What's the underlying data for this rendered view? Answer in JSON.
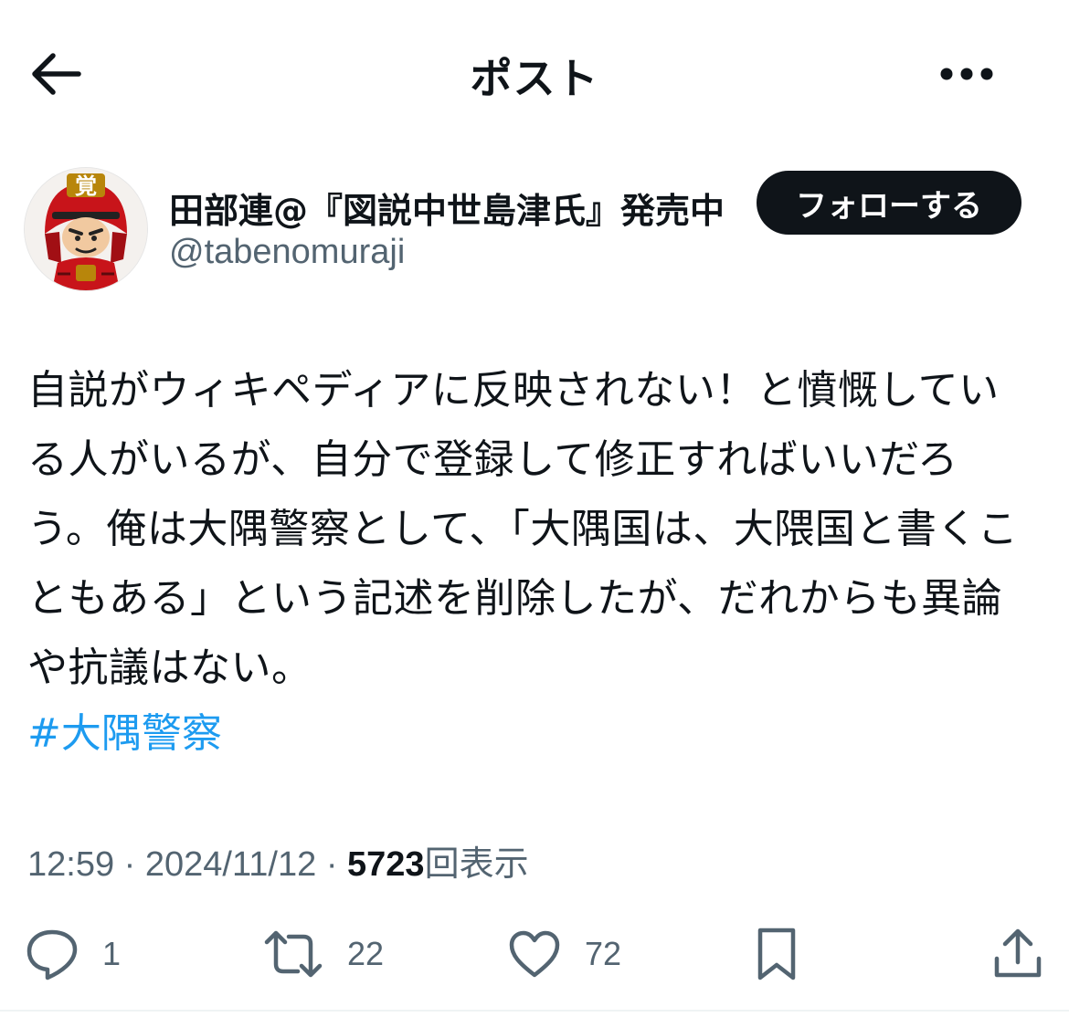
{
  "header": {
    "title": "ポスト"
  },
  "author": {
    "display_name": "田部連@『図説中世島津氏』発売中",
    "handle": "@tabenomuraji",
    "follow_label": "フォローする",
    "avatar_kanji": "覚"
  },
  "tweet": {
    "text": "自説がウィキペディアに反映されない！と憤慨している人がいるが、自分で登録して修正すればいいだろう。俺は大隅警察として、「大隅国は、大隈国と書くこともある」という記述を削除したが、だれからも異論や抗議はない。",
    "hashtag": "#大隅警察"
  },
  "meta": {
    "time": "12:59",
    "separator": "·",
    "date": "2024/11/12",
    "views_count": "5723",
    "views_label": "回表示"
  },
  "actions": {
    "reply_count": "1",
    "repost_count": "22",
    "like_count": "72"
  },
  "colors": {
    "text": "#0f1419",
    "secondary": "#536471",
    "link": "#1d9bf0",
    "button_bg": "#0f1419"
  }
}
